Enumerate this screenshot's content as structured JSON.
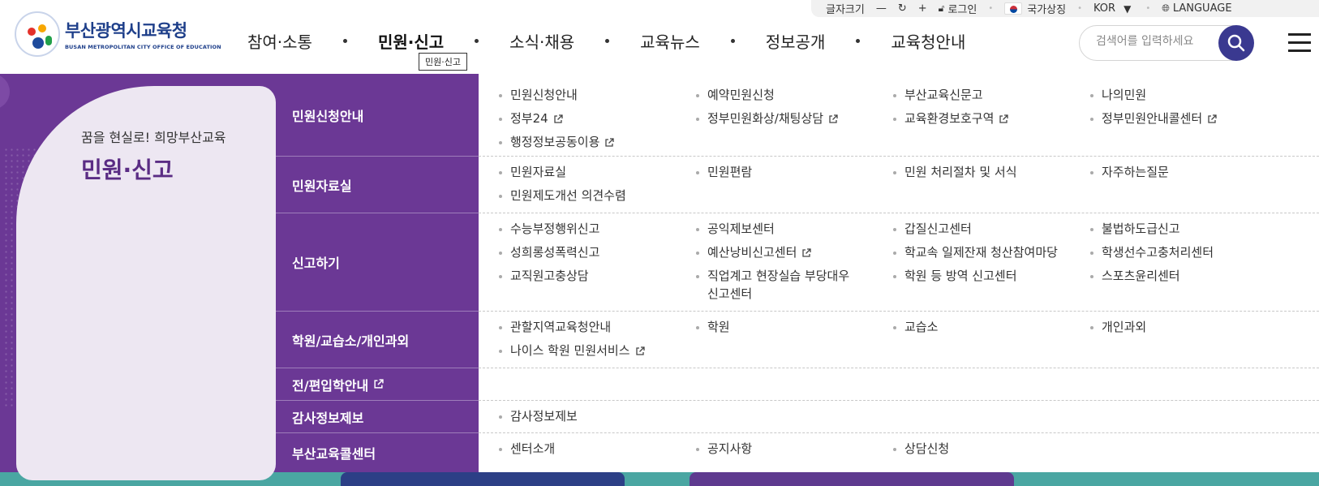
{
  "utility": {
    "font_size_label": "글자크기",
    "minus": "—",
    "refresh": "↻",
    "plus": "+",
    "login": "로그인",
    "national_symbol": "국가상징",
    "lang_code": "KOR",
    "language": "LANGUAGE"
  },
  "logo": {
    "name_ko": "부산광역시교육청",
    "name_en": "BUSAN METROPOLITAN CITY OFFICE OF EDUCATION"
  },
  "gnb": {
    "items": [
      "참여·소통",
      "민원·신고",
      "소식·채용",
      "교육뉴스",
      "정보공개",
      "교육청안내"
    ],
    "active_index": 1
  },
  "tooltip": "민원·신고",
  "search": {
    "placeholder": "검색어를 입력하세요"
  },
  "mega": {
    "slogan": "꿈을 현실로! 희망부산교육",
    "title": "민원·신고",
    "categories": [
      {
        "label": "민원신청안내",
        "links": [
          "민원신청안내",
          "예약민원신청",
          "부산교육신문고",
          "나의민원",
          "정부24",
          "정부민원화상/채팅상담",
          "교육환경보호구역",
          "정부민원안내콜센터",
          "행정정보공동이용"
        ]
      },
      {
        "label": "민원자료실",
        "links": [
          "민원자료실",
          "민원편람",
          "민원 처리절차 및 서식",
          "자주하는질문",
          "민원제도개선 의견수렴"
        ]
      },
      {
        "label": "신고하기",
        "links": [
          "수능부정행위신고",
          "공익제보센터",
          "갑질신고센터",
          "불법하도급신고",
          "성희롱성폭력신고",
          "예산낭비신고센터",
          "학교속 일제잔재 청산참여마당",
          "학생선수고충처리센터",
          "교직원고충상담",
          "직업계고 현장실습 부당대우\n신고센터",
          "학원 등 방역 신고센터",
          "스포츠윤리센터"
        ]
      },
      {
        "label": "학원/교습소/개인과외",
        "links": [
          "관할지역교육청안내",
          "학원",
          "교습소",
          "개인과외",
          "나이스 학원 민원서비스"
        ]
      },
      {
        "label": "전/편입학안내",
        "links": []
      },
      {
        "label": "감사정보제보",
        "links": [
          "감사정보제보"
        ]
      },
      {
        "label": "부산교육콜센터",
        "links": [
          "센터소개",
          "공지사항",
          "상담신청"
        ]
      }
    ]
  },
  "colors": {
    "purple": "#6b3895",
    "title_purple": "#5a2c84",
    "search_button": "#3a3990"
  }
}
